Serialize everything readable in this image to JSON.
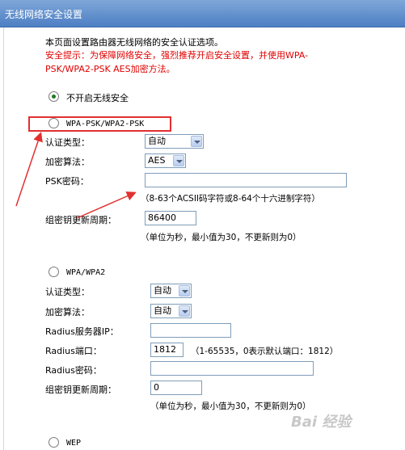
{
  "header": {
    "title": "无线网络安全设置"
  },
  "intro": "本页面设置路由器无线网络的安全认证选项。",
  "warning": {
    "line1": "安全提示：为保障网络安全，强烈推荐开启安全设置，并使用WPA-",
    "line2": "PSK/WPA2-PSK AES加密方法。"
  },
  "options": {
    "disable": "不开启无线安全",
    "psk": "WPA-PSK/WPA2-PSK",
    "wpa": "WPA/WPA2",
    "wep": "WEP"
  },
  "psk_section": {
    "auth_label": "认证类型：",
    "auth_value": "自动",
    "enc_label": "加密算法：",
    "enc_value": "AES",
    "password_label": "PSK密码：",
    "password_value": "",
    "password_hint": "（8-63个ACSII码字符或8-64个十六进制字符）",
    "renew_label": "组密钥更新周期：",
    "renew_value": "86400",
    "renew_hint": "（单位为秒，最小值为30，不更新则为0）"
  },
  "wpa_section": {
    "auth_label": "认证类型：",
    "auth_value": "自动",
    "enc_label": "加密算法：",
    "enc_value": "自动",
    "radius_ip_label": "Radius服务器IP：",
    "radius_ip_value": "",
    "radius_port_label": "Radius端口：",
    "radius_port_value": "1812",
    "radius_port_hint": "（1-65535，0表示默认端口：1812）",
    "radius_pwd_label": "Radius密码：",
    "radius_pwd_value": "",
    "renew_label": "组密钥更新周期：",
    "renew_value": "0",
    "renew_hint": "（单位为秒，最小值为30，不更新则为0）"
  },
  "watermark": "Bai 经验",
  "colors": {
    "header": "#5a8acb",
    "warning": "#e00000",
    "highlight": "#e23030",
    "radio_dot": "#1f7a1f"
  }
}
